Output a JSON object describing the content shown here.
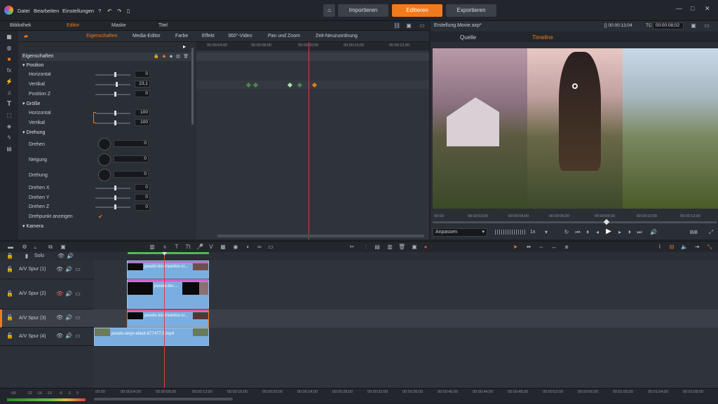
{
  "menu": {
    "items": [
      "Datei",
      "Bearbeiten",
      "Einstellungen"
    ]
  },
  "modes": {
    "import": "Importieren",
    "edit": "Editieren",
    "export": "Exportieren"
  },
  "lefttabs": {
    "library": "Bibliothek",
    "editor": "Editor",
    "mask": "Maske",
    "title": "Titel"
  },
  "subtabs": [
    "Eigenschaften",
    "Media-Editor",
    "Farbe",
    "Effekt",
    "360°-Video",
    "Pan und Zoom",
    "Zeit-Neuzuordnung"
  ],
  "props": {
    "header": "Eigenschaften",
    "position": "Position",
    "horizontal": "Horizontal",
    "vertikal": "Vertikal",
    "posz": "Position Z",
    "groesse": "Größe",
    "ghorizontal": "Horizontal",
    "gvertikal": "Vertikal",
    "drehung": "Drehung",
    "drehen": "Drehen",
    "neigung": "Neigung",
    "drehung2": "Drehung",
    "drehenx": "Drehen X",
    "dreheny": "Drehen Y",
    "drehenz": "Drehen Z",
    "drehpunkt": "Drehpunkt anzeigen",
    "kamera": "Kamera"
  },
  "values": {
    "h": "0",
    "v": "23,1",
    "z": "0",
    "gh": "100",
    "gv": "100",
    "dr": "0",
    "ne": "0",
    "du": "0",
    "dx": "0",
    "dy": "0",
    "dz": "0"
  },
  "kf_ticks": [
    "00:00:04;00",
    "00:00:08;00",
    "00:00:00;00",
    "00:00:16;00",
    "00:00:12;00"
  ],
  "preview": {
    "filename": "Erstellung.Movie.axp*",
    "tc1": "00:00:13;04",
    "tc_label": "TC",
    "tc2": "00:00:08;02",
    "source": "Quelle",
    "timeline": "Timeline",
    "fit": "Anpassen",
    "speed": "1x",
    "bib": "BiB",
    "ticks": [
      "00:00",
      "00:00:02;00",
      "00:00:04;00",
      "00:00:06;00",
      "00:00:08;00",
      "00:00:10;00",
      "00:00:12;00"
    ]
  },
  "timeline": {
    "solo": "Solo",
    "tracks": [
      {
        "name": "A/V Spur (1)",
        "clip": "pexels-los-muertos-cr..."
      },
      {
        "name": "A/V Spur (2)",
        "clip": "pexels-los-..."
      },
      {
        "name": "A/V Spur (3)",
        "clip": "pexels-los-muertos-cr..."
      },
      {
        "name": "A/V Spur (4)",
        "clip": "pexels-taryn-elliott-877477.5.mp4"
      }
    ],
    "ticks": [
      "00:00",
      "00:00:04;00",
      "00:00:08;00",
      "00:00:12;00",
      "00:00:16;00",
      "00:00:20;00",
      "00:00:24;00",
      "00:00:28;00",
      "00:00:32;00",
      "00:00:36;00",
      "00:00:40;00",
      "00:00:44;00",
      "00:00:48;00",
      "00:00:52;00",
      "00:00:56;00",
      "00:01:00;00",
      "00:01:04;00",
      "00:01:08;00"
    ],
    "meter": [
      "-60",
      "-22",
      "-16",
      "-10",
      "-6",
      "-3",
      "0"
    ]
  }
}
